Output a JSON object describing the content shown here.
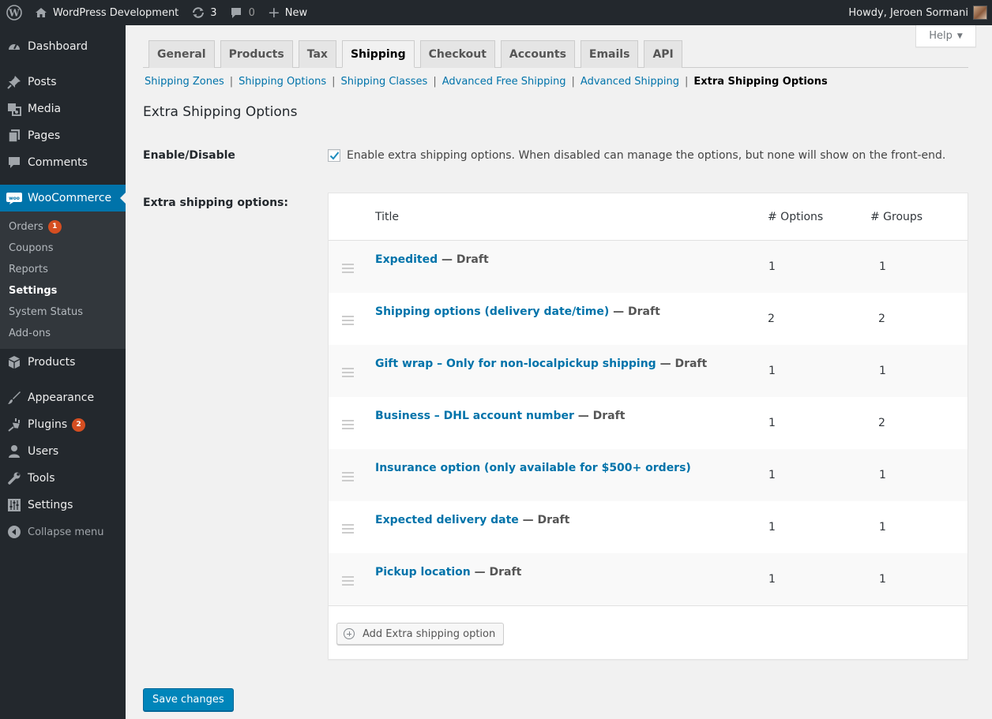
{
  "adminbar": {
    "site_name": "WordPress Development",
    "updates_count": "3",
    "comments_count": "0",
    "new_label": "New",
    "greeting": "Howdy, Jeroen Sormani"
  },
  "sidebar": {
    "dashboard": "Dashboard",
    "posts": "Posts",
    "media": "Media",
    "pages": "Pages",
    "comments": "Comments",
    "woocommerce": "WooCommerce",
    "woo_sub": {
      "orders": "Orders",
      "orders_badge": "1",
      "coupons": "Coupons",
      "reports": "Reports",
      "settings": "Settings",
      "system_status": "System Status",
      "addons": "Add-ons"
    },
    "products": "Products",
    "appearance": "Appearance",
    "plugins": "Plugins",
    "plugins_badge": "2",
    "users": "Users",
    "tools": "Tools",
    "settings": "Settings",
    "collapse": "Collapse menu"
  },
  "help": {
    "label": "Help"
  },
  "tabs": {
    "general": "General",
    "products": "Products",
    "tax": "Tax",
    "shipping": "Shipping",
    "checkout": "Checkout",
    "accounts": "Accounts",
    "emails": "Emails",
    "api": "API"
  },
  "subnav": {
    "zones": "Shipping Zones",
    "options": "Shipping Options",
    "classes": "Shipping Classes",
    "adv_free": "Advanced Free Shipping",
    "adv": "Advanced Shipping",
    "extra": "Extra Shipping Options",
    "separator": "|"
  },
  "page": {
    "title": "Extra Shipping Options",
    "enable_label": "Enable/Disable",
    "enable_text": "Enable extra shipping options. When disabled can manage the options, but none will show on the front-end.",
    "options_label": "Extra shipping options:"
  },
  "table": {
    "col_title": "Title",
    "col_options": "# Options",
    "col_groups": "# Groups",
    "rows": [
      {
        "title": "Expedited",
        "status": " — Draft",
        "options": "1",
        "groups": "1"
      },
      {
        "title": "Shipping options (delivery date/time)",
        "status": " — Draft",
        "options": "2",
        "groups": "2"
      },
      {
        "title": "Gift wrap – Only for non-localpickup shipping",
        "status": " — Draft",
        "options": "1",
        "groups": "1"
      },
      {
        "title": "Business – DHL account number",
        "status": " — Draft",
        "options": "1",
        "groups": "2"
      },
      {
        "title": "Insurance option (only available for $500+ orders)",
        "status": "",
        "options": "1",
        "groups": "1"
      },
      {
        "title": "Expected delivery date",
        "status": " — Draft",
        "options": "1",
        "groups": "1"
      },
      {
        "title": "Pickup location",
        "status": " — Draft",
        "options": "1",
        "groups": "1"
      }
    ],
    "add_button": "Add Extra shipping option"
  },
  "save_button": "Save changes",
  "colors": {
    "accent": "#0073aa",
    "primary_button": "#0085ba",
    "sidebar_bg": "#23282d",
    "badge": "#d54e21"
  }
}
